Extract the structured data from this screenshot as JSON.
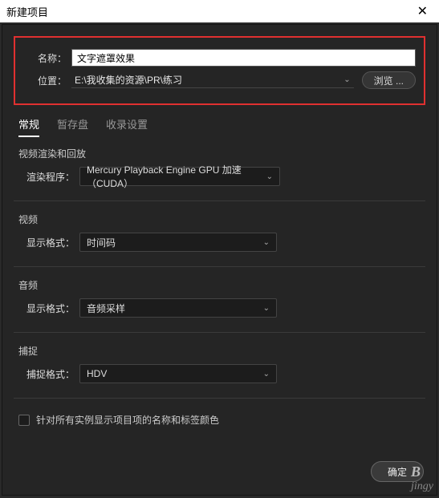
{
  "title": "新建项目",
  "name_field": {
    "label": "名称：",
    "value": "文字遮罩效果"
  },
  "location_field": {
    "label": "位置：",
    "value": "E:\\我收集的资源\\PR\\练习",
    "browse": "浏览 ..."
  },
  "tabs": {
    "general": "常规",
    "scratch": "暂存盘",
    "ingest": "收录设置"
  },
  "video_render": {
    "section": "视频渲染和回放",
    "label": "渲染程序：",
    "value": "Mercury Playback Engine GPU 加速（CUDA）"
  },
  "video": {
    "section": "视频",
    "label": "显示格式：",
    "value": "时间码"
  },
  "audio": {
    "section": "音频",
    "label": "显示格式：",
    "value": "音频采样"
  },
  "capture": {
    "section": "捕捉",
    "label": "捕捉格式：",
    "value": "HDV"
  },
  "checkbox_label": "针对所有实例显示项目项的名称和标签颜色",
  "ok": "确定",
  "watermark": "jingy"
}
